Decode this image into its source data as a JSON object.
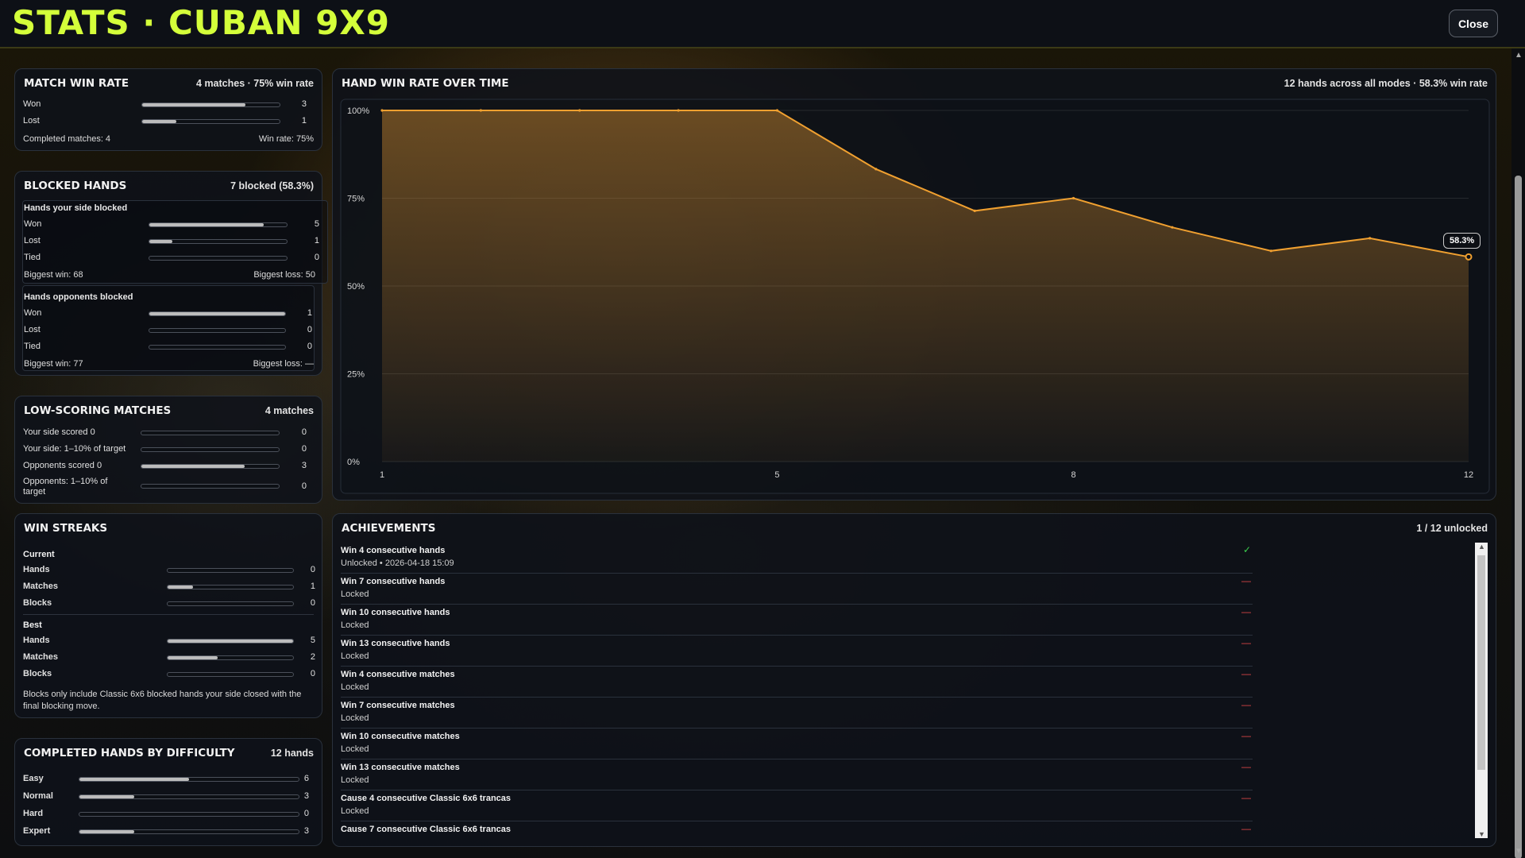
{
  "header": {
    "title": "STATS · CUBAN 9X9",
    "close_label": "Close"
  },
  "match_win_rate": {
    "title": "MATCH WIN RATE",
    "meta": "4 matches · 75% win rate",
    "rows": [
      {
        "label": "Won",
        "value": "3",
        "fraction": 0.75
      },
      {
        "label": "Lost",
        "value": "1",
        "fraction": 0.25
      }
    ],
    "footer_left": "Completed matches: 4",
    "footer_right": "Win rate: 75%"
  },
  "blocked_hands": {
    "title": "BLOCKED HANDS",
    "meta": "7 blocked (58.3%)",
    "your_side": {
      "title": "Hands your side blocked",
      "rows": [
        {
          "label": "Won",
          "value": "5",
          "fraction": 0.83
        },
        {
          "label": "Lost",
          "value": "1",
          "fraction": 0.17
        },
        {
          "label": "Tied",
          "value": "0",
          "fraction": 0
        }
      ],
      "biggest_win": "Biggest win: 68",
      "biggest_loss": "Biggest loss: 50"
    },
    "opponents": {
      "title": "Hands opponents blocked",
      "rows": [
        {
          "label": "Won",
          "value": "1",
          "fraction": 1.0
        },
        {
          "label": "Lost",
          "value": "0",
          "fraction": 0
        },
        {
          "label": "Tied",
          "value": "0",
          "fraction": 0
        }
      ],
      "biggest_win": "Biggest win: 77",
      "biggest_loss": "Biggest loss: —"
    }
  },
  "low_scoring": {
    "title": "LOW-SCORING MATCHES",
    "meta": "4 matches",
    "rows": [
      {
        "label": "Your side scored 0",
        "value": "0",
        "fraction": 0
      },
      {
        "label": "Your side: 1–10% of target",
        "value": "0",
        "fraction": 0
      },
      {
        "label": "Opponents scored 0",
        "value": "3",
        "fraction": 0.75
      },
      {
        "label": "Opponents: 1–10% of",
        "label2": "target",
        "value": "0",
        "fraction": 0
      }
    ]
  },
  "win_streaks": {
    "title": "WIN STREAKS",
    "current_label": "Current",
    "current": [
      {
        "label": "Hands",
        "value": "0",
        "fraction": 0
      },
      {
        "label": "Matches",
        "value": "1",
        "fraction": 0.2
      },
      {
        "label": "Blocks",
        "value": "0",
        "fraction": 0
      }
    ],
    "best_label": "Best",
    "best": [
      {
        "label": "Hands",
        "value": "5",
        "fraction": 1.0
      },
      {
        "label": "Matches",
        "value": "2",
        "fraction": 0.4
      },
      {
        "label": "Blocks",
        "value": "0",
        "fraction": 0
      }
    ],
    "note": "Blocks only include Classic 6x6 blocked hands your side closed with the final blocking move."
  },
  "difficulty": {
    "title": "COMPLETED HANDS BY DIFFICULTY",
    "meta": "12 hands",
    "rows": [
      {
        "label": "Easy",
        "value": "6",
        "fraction": 0.5
      },
      {
        "label": "Normal",
        "value": "3",
        "fraction": 0.25
      },
      {
        "label": "Hard",
        "value": "0",
        "fraction": 0
      },
      {
        "label": "Expert",
        "value": "3",
        "fraction": 0.25
      }
    ]
  },
  "chart_panel": {
    "title": "HAND WIN RATE OVER TIME",
    "meta": "12 hands across all modes · 58.3% win rate"
  },
  "chart_data": {
    "type": "area",
    "x": [
      1,
      2,
      3,
      4,
      5,
      6,
      7,
      8,
      9,
      10,
      11,
      12
    ],
    "series": [
      {
        "values": [
          100,
          100,
          100,
          100,
          100,
          83.3,
          71.4,
          75,
          66.7,
          60,
          63.6,
          58.3
        ]
      }
    ],
    "ylim": [
      0,
      100
    ],
    "y_ticks": [
      "0%",
      "25%",
      "50%",
      "75%",
      "100%"
    ],
    "x_ticks": [
      "1",
      "5",
      "8",
      "12"
    ],
    "x_tick_values": [
      1,
      5,
      8,
      12
    ],
    "last_label": "58.3%",
    "grid": true,
    "line_color": "#f0a030"
  },
  "achievements": {
    "title": "ACHIEVEMENTS",
    "meta": "1 / 12 unlocked",
    "items": [
      {
        "name": "Win 4 consecutive hands",
        "status": "Unlocked • 2026-04-18 15:09",
        "unlocked": true,
        "mark": "✓"
      },
      {
        "name": "Win 7 consecutive hands",
        "status": "Locked",
        "unlocked": false,
        "mark": "—"
      },
      {
        "name": "Win 10 consecutive hands",
        "status": "Locked",
        "unlocked": false,
        "mark": "—"
      },
      {
        "name": "Win 13 consecutive hands",
        "status": "Locked",
        "unlocked": false,
        "mark": "—"
      },
      {
        "name": "Win 4 consecutive matches",
        "status": "Locked",
        "unlocked": false,
        "mark": "—"
      },
      {
        "name": "Win 7 consecutive matches",
        "status": "Locked",
        "unlocked": false,
        "mark": "—"
      },
      {
        "name": "Win 10 consecutive matches",
        "status": "Locked",
        "unlocked": false,
        "mark": "—"
      },
      {
        "name": "Win 13 consecutive matches",
        "status": "Locked",
        "unlocked": false,
        "mark": "—"
      },
      {
        "name": "Cause 4 consecutive Classic 6x6 trancas",
        "status": "Locked",
        "unlocked": false,
        "mark": "—"
      },
      {
        "name": "Cause 7 consecutive Classic 6x6 trancas",
        "status": "",
        "unlocked": false,
        "mark": "—"
      }
    ]
  },
  "colors": {
    "accent": "#d4ff3a",
    "unlocked": "#3ccf4e",
    "locked": "#e04848"
  }
}
